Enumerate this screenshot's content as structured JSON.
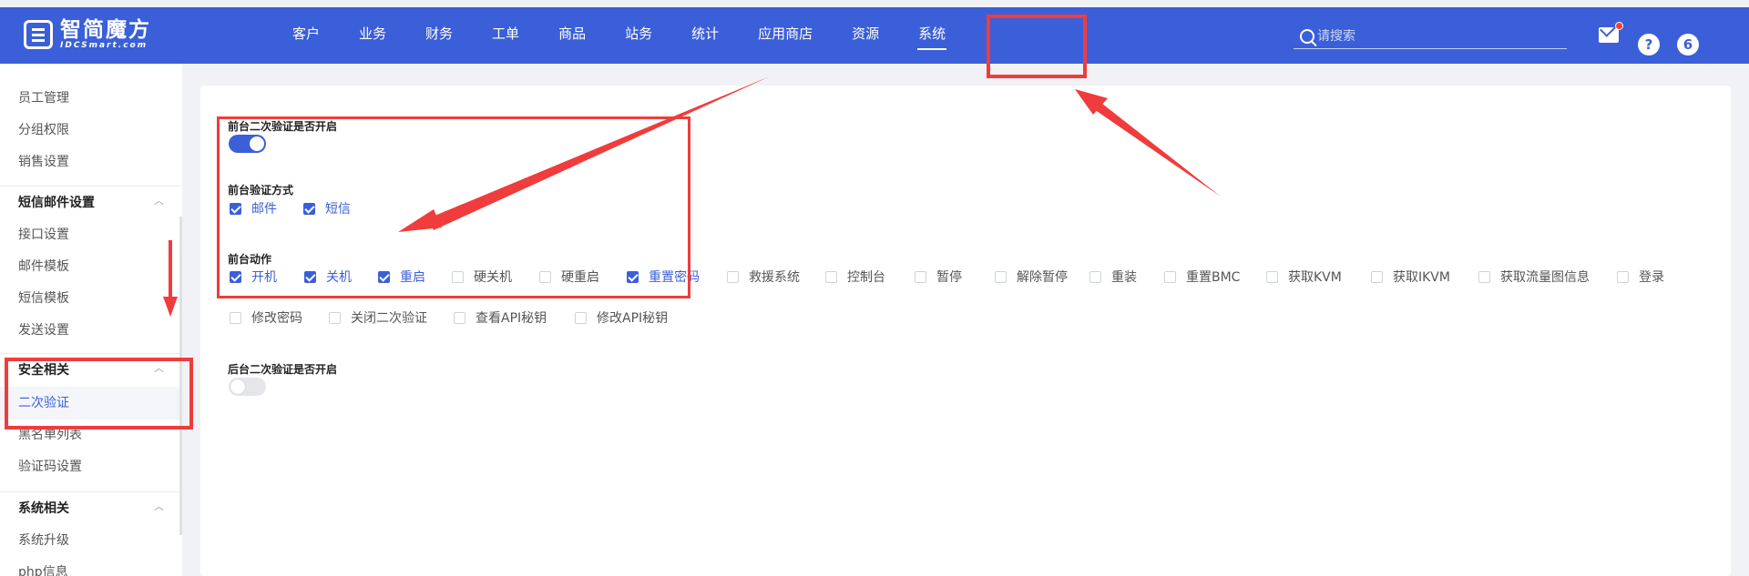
{
  "logo": {
    "cn": "智简魔方",
    "en": "IDCSmart.com"
  },
  "nav": [
    "客户",
    "业务",
    "财务",
    "工单",
    "商品",
    "站务",
    "统计",
    "应用商店",
    "资源",
    "系统"
  ],
  "search": {
    "placeholder": "请搜索"
  },
  "header_icons": {
    "help": "?",
    "user": "6"
  },
  "sidebar": {
    "items_top": [
      "员工管理",
      "分组权限",
      "销售设置"
    ],
    "group_sms": "短信邮件设置",
    "items_sms": [
      "接口设置",
      "邮件模板",
      "短信模板",
      "发送设置"
    ],
    "group_security": "安全相关",
    "items_security": [
      "二次验证",
      "黑名单列表",
      "验证码设置"
    ],
    "group_system": "系统相关",
    "items_system": [
      "系统升级",
      "php信息"
    ]
  },
  "form": {
    "front_2fa_label": "前台二次验证是否开启",
    "front_2fa_enabled": true,
    "front_method_label": "前台验证方式",
    "methods": [
      {
        "label": "邮件",
        "checked": true
      },
      {
        "label": "短信",
        "checked": true
      }
    ],
    "front_action_label": "前台动作",
    "actions": [
      {
        "label": "开机",
        "checked": true
      },
      {
        "label": "关机",
        "checked": true
      },
      {
        "label": "重启",
        "checked": true
      },
      {
        "label": "硬关机",
        "checked": false
      },
      {
        "label": "硬重启",
        "checked": false
      },
      {
        "label": "重置密码",
        "checked": true
      },
      {
        "label": "救援系统",
        "checked": false
      },
      {
        "label": "控制台",
        "checked": false
      },
      {
        "label": "暂停",
        "checked": false
      },
      {
        "label": "解除暂停",
        "checked": false
      },
      {
        "label": "重装",
        "checked": false
      },
      {
        "label": "重置BMC",
        "checked": false
      },
      {
        "label": "获取KVM",
        "checked": false
      },
      {
        "label": "获取IKVM",
        "checked": false
      },
      {
        "label": "获取流量图信息",
        "checked": false
      },
      {
        "label": "登录",
        "checked": false
      },
      {
        "label": "修改密码",
        "checked": false
      },
      {
        "label": "关闭二次验证",
        "checked": false
      },
      {
        "label": "查看API秘钥",
        "checked": false
      },
      {
        "label": "修改API秘钥",
        "checked": false
      }
    ],
    "back_2fa_label": "后台二次验证是否开启",
    "back_2fa_enabled": false
  },
  "colors": {
    "primary": "#3b5fd8",
    "annotation": "#f03c3c"
  }
}
